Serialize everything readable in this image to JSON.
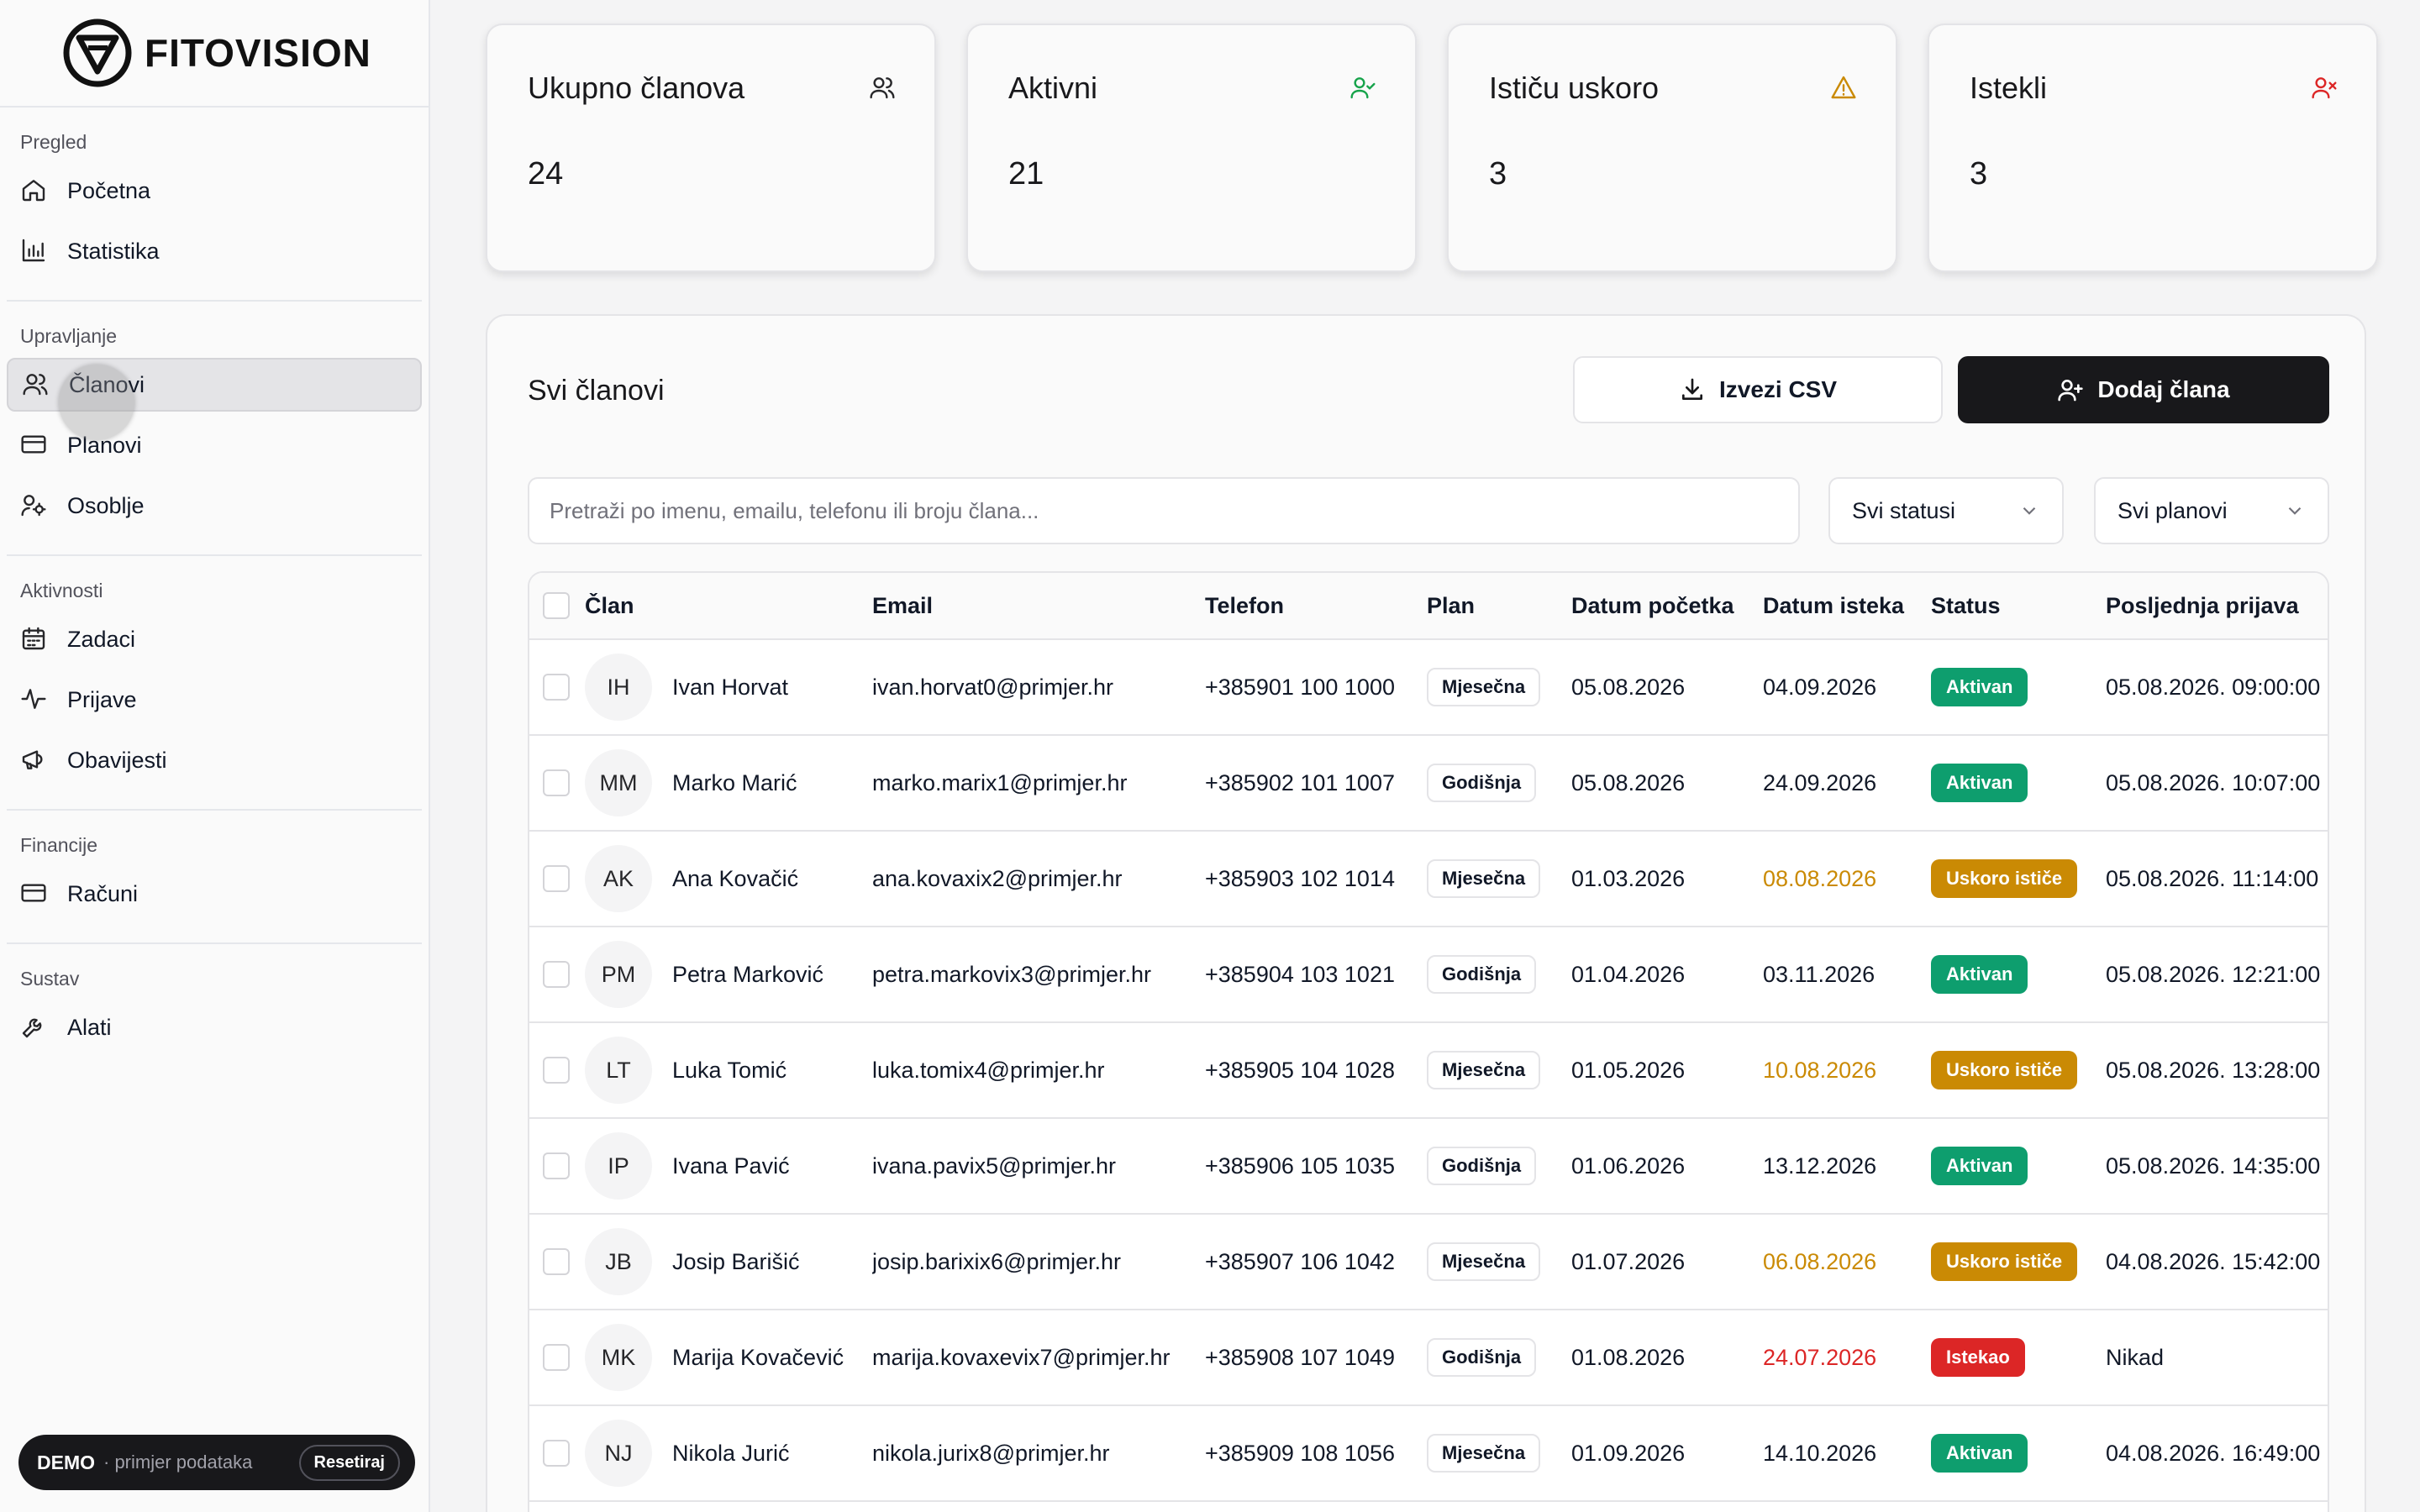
{
  "brand": {
    "name": "FITOVISION"
  },
  "sidebar": {
    "groups": [
      {
        "title": "Pregled",
        "items": [
          {
            "label": "Početna",
            "icon": "home-icon"
          },
          {
            "label": "Statistika",
            "icon": "bar-chart-icon"
          }
        ]
      },
      {
        "title": "Upravljanje",
        "items": [
          {
            "label": "Članovi",
            "icon": "users-icon",
            "active": true
          },
          {
            "label": "Planovi",
            "icon": "card-icon"
          },
          {
            "label": "Osoblje",
            "icon": "staff-icon"
          }
        ]
      },
      {
        "title": "Aktivnosti",
        "items": [
          {
            "label": "Zadaci",
            "icon": "calendar-icon"
          },
          {
            "label": "Prijave",
            "icon": "activity-icon"
          },
          {
            "label": "Obavijesti",
            "icon": "megaphone-icon"
          }
        ]
      },
      {
        "title": "Financije",
        "items": [
          {
            "label": "Računi",
            "icon": "card-icon"
          }
        ]
      },
      {
        "title": "Sustav",
        "items": [
          {
            "label": "Alati",
            "icon": "wrench-icon"
          }
        ]
      }
    ]
  },
  "demo": {
    "label": "DEMO",
    "sub": "· primjer podataka",
    "reset": "Resetiraj"
  },
  "stats": [
    {
      "title": "Ukupno članova",
      "value": "24",
      "icon": "users-icon",
      "color": "#27272a"
    },
    {
      "title": "Aktivni",
      "value": "21",
      "icon": "user-check-icon",
      "color": "#16a34a"
    },
    {
      "title": "Ističu uskoro",
      "value": "3",
      "icon": "warning-icon",
      "color": "#ca8a04"
    },
    {
      "title": "Istekli",
      "value": "3",
      "icon": "user-x-icon",
      "color": "#dc2626"
    }
  ],
  "members_panel": {
    "title": "Svi članovi",
    "export_label": "Izvezi CSV",
    "add_label": "Dodaj člana",
    "search_placeholder": "Pretraži po imenu, emailu, telefonu ili broju člana...",
    "status_filter": "Svi statusi",
    "plan_filter": "Svi planovi"
  },
  "table": {
    "headers": {
      "member": "Član",
      "email": "Email",
      "phone": "Telefon",
      "plan": "Plan",
      "start": "Datum početka",
      "end": "Datum isteka",
      "status": "Status",
      "last": "Posljednja prijava"
    },
    "rows": [
      {
        "initials": "IH",
        "name": "Ivan Horvat",
        "email": "ivan.horvat0@primjer.hr",
        "phone": "+385901 100 1000",
        "plan": "Mjesečna",
        "start": "05.08.2026",
        "end": "04.09.2026",
        "end_state": "normal",
        "status": "Aktivan",
        "status_type": "aktivan",
        "last": "05.08.2026. 09:00:00"
      },
      {
        "initials": "MM",
        "name": "Marko Marić",
        "email": "marko.marix1@primjer.hr",
        "phone": "+385902 101 1007",
        "plan": "Godišnja",
        "start": "05.08.2026",
        "end": "24.09.2026",
        "end_state": "normal",
        "status": "Aktivan",
        "status_type": "aktivan",
        "last": "05.08.2026. 10:07:00"
      },
      {
        "initials": "AK",
        "name": "Ana Kovačić",
        "email": "ana.kovaxix2@primjer.hr",
        "phone": "+385903 102 1014",
        "plan": "Mjesečna",
        "start": "01.03.2026",
        "end": "08.08.2026",
        "end_state": "warn",
        "status": "Uskoro ističe",
        "status_type": "uskoro",
        "last": "05.08.2026. 11:14:00"
      },
      {
        "initials": "PM",
        "name": "Petra Marković",
        "email": "petra.markovix3@primjer.hr",
        "phone": "+385904 103 1021",
        "plan": "Godišnja",
        "start": "01.04.2026",
        "end": "03.11.2026",
        "end_state": "normal",
        "status": "Aktivan",
        "status_type": "aktivan",
        "last": "05.08.2026. 12:21:00"
      },
      {
        "initials": "LT",
        "name": "Luka Tomić",
        "email": "luka.tomix4@primjer.hr",
        "phone": "+385905 104 1028",
        "plan": "Mjesečna",
        "start": "01.05.2026",
        "end": "10.08.2026",
        "end_state": "warn",
        "status": "Uskoro ističe",
        "status_type": "uskoro",
        "last": "05.08.2026. 13:28:00"
      },
      {
        "initials": "IP",
        "name": "Ivana Pavić",
        "email": "ivana.pavix5@primjer.hr",
        "phone": "+385906 105 1035",
        "plan": "Godišnja",
        "start": "01.06.2026",
        "end": "13.12.2026",
        "end_state": "normal",
        "status": "Aktivan",
        "status_type": "aktivan",
        "last": "05.08.2026. 14:35:00"
      },
      {
        "initials": "JB",
        "name": "Josip Barišić",
        "email": "josip.barixix6@primjer.hr",
        "phone": "+385907 106 1042",
        "plan": "Mjesečna",
        "start": "01.07.2026",
        "end": "06.08.2026",
        "end_state": "warn",
        "status": "Uskoro ističe",
        "status_type": "uskoro",
        "last": "04.08.2026. 15:42:00"
      },
      {
        "initials": "MK",
        "name": "Marija Kovačević",
        "email": "marija.kovaxevix7@primjer.hr",
        "phone": "+385908 107 1049",
        "plan": "Godišnja",
        "start": "01.08.2026",
        "end": "24.07.2026",
        "end_state": "bad",
        "status": "Istekao",
        "status_type": "istekao",
        "last": "Nikad"
      },
      {
        "initials": "NJ",
        "name": "Nikola Jurić",
        "email": "nikola.jurix8@primjer.hr",
        "phone": "+385909 108 1056",
        "plan": "Mjesečna",
        "start": "01.09.2026",
        "end": "14.10.2026",
        "end_state": "normal",
        "status": "Aktivan",
        "status_type": "aktivan",
        "last": "04.08.2026. 16:49:00"
      }
    ]
  }
}
